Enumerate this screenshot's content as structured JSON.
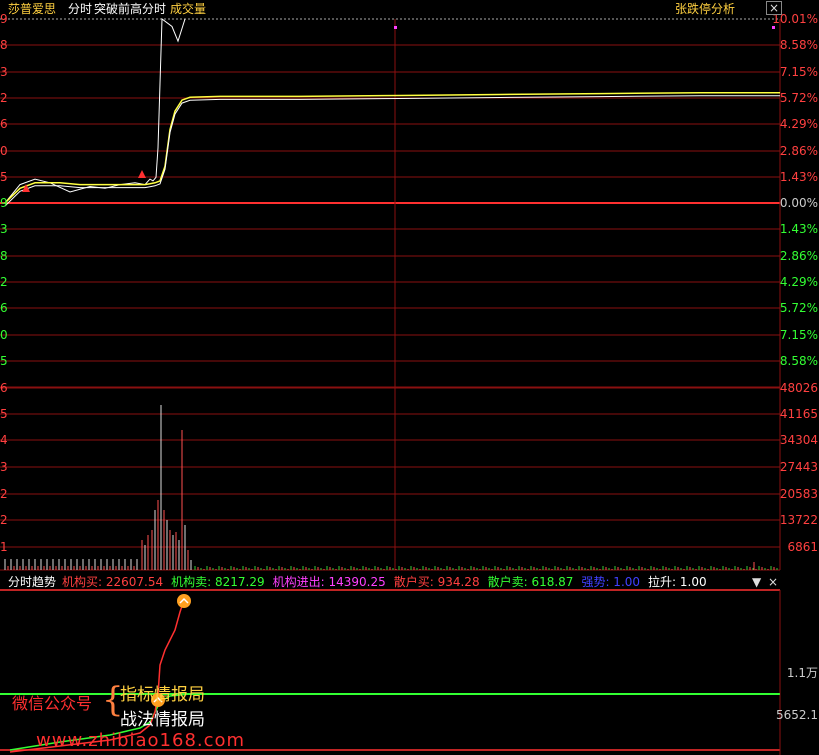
{
  "header": {
    "app_name": "莎普爱思",
    "mode": "分时",
    "indicator": "突破前高分时",
    "volume_label": "成交量",
    "tool": "张跌停分析",
    "close_label": "×"
  },
  "price_axis": {
    "right_labels": [
      "10.01%",
      "8.58%",
      "7.15%",
      "5.72%",
      "4.29%",
      "2.86%",
      "1.43%",
      "0.00%",
      "1.43%",
      "2.86%",
      "4.29%",
      "5.72%",
      "7.15%",
      "8.58%"
    ],
    "left_labels": [
      "9",
      "8",
      "3",
      "2",
      "6",
      "0",
      "5",
      "9",
      "3",
      "8",
      "2",
      "6",
      "0",
      "5"
    ]
  },
  "volume_axis": {
    "right_labels": [
      "48026",
      "41165",
      "34304",
      "27443",
      "20583",
      "13722",
      "6861"
    ],
    "left_labels": [
      "6",
      "5",
      "4",
      "3",
      "2",
      "2",
      "1"
    ]
  },
  "indicator_panel": {
    "title": "分时趋势",
    "items": [
      {
        "label": "机构买:",
        "value": "22607.54",
        "color": "#ff4040"
      },
      {
        "label": "机构卖:",
        "value": "8217.29",
        "color": "#33ff33"
      },
      {
        "label": "机构进出:",
        "value": "14390.25",
        "color": "#ff40ff"
      },
      {
        "label": "散户买:",
        "value": "934.28",
        "color": "#ff4040"
      },
      {
        "label": "散户卖:",
        "value": "618.87",
        "color": "#33ff33"
      },
      {
        "label": "强势:",
        "value": "1.00",
        "color": "#4040ff"
      },
      {
        "label": "拉升:",
        "value": "1.00",
        "color": "#ffffff"
      }
    ],
    "right_labels": [
      "1.1万",
      "5652.1"
    ],
    "dropdown_icon": "▼",
    "close_icon": "×"
  },
  "watermark": {
    "left": "微信公众号",
    "brace": "{",
    "line1": "指标情报局",
    "line2": "战法情报局",
    "url": "www.zhibiao168.com"
  },
  "chart_data": {
    "type": "line",
    "series": [
      {
        "values": [
          0.0,
          1.0,
          1.3,
          1.1,
          0.6,
          0.9,
          0.8,
          1.0,
          1.1,
          1.0,
          1.3,
          1.2,
          1.4,
          3.0,
          6.5,
          10.01,
          9.6,
          8.8,
          10.01
        ]
      },
      {
        "values": [
          0.0,
          0.8,
          1.1,
          1.1,
          1.0,
          1.0,
          1.0,
          1.0,
          1.0,
          1.0,
          1.05,
          1.1,
          1.2,
          2.0,
          4.0,
          5.0,
          5.6,
          5.75,
          5.8,
          5.8,
          5.85,
          5.9,
          5.95,
          6.0,
          6.0
        ]
      }
    ]
  }
}
